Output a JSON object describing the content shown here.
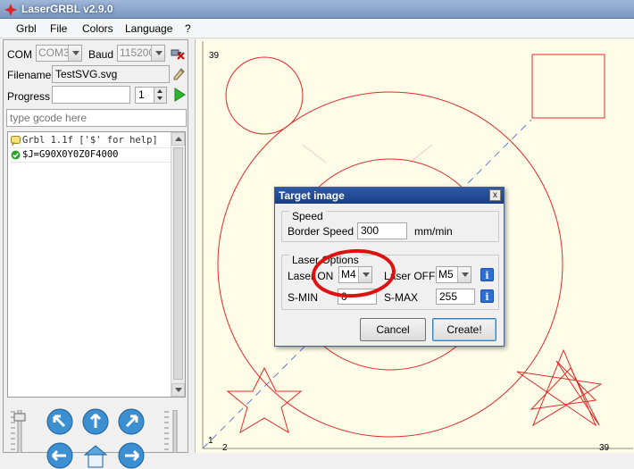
{
  "window": {
    "title": "LaserGRBL v2.9.0"
  },
  "menu": [
    "Grbl",
    "File",
    "Colors",
    "Language",
    "?"
  ],
  "connection": {
    "com_label": "COM",
    "com_value": "COM3",
    "baud_label": "Baud",
    "baud_value": "115200"
  },
  "file": {
    "filename_label": "Filename",
    "filename_value": "TestSVG.svg"
  },
  "progress": {
    "label": "Progress",
    "passes": "1"
  },
  "gcode_input": {
    "placeholder": "type gcode here"
  },
  "console": {
    "lines": [
      {
        "text": "Grbl 1.1f ['$' for help]",
        "icon": "info-bubble-icon"
      },
      {
        "text": "$J=G90X0Y0Z0F4000",
        "icon": "check-ok-icon"
      }
    ]
  },
  "canvas": {
    "y_top_label": "39",
    "y_bottom_label": "1",
    "x_left_label": "2",
    "x_right_label": "39"
  },
  "dialog": {
    "title": "Target image",
    "close_label": "x",
    "speed_group": "Speed",
    "border_speed_label": "Border Speed",
    "border_speed_value": "300",
    "speed_unit": "mm/min",
    "laser_group": "Laser Options",
    "laser_on_label": "Laser ON",
    "laser_on_value": "M4",
    "laser_off_label": "Laser OFF",
    "laser_off_value": "M5",
    "smin_label": "S-MIN",
    "smin_value": "0",
    "smax_label": "S-MAX",
    "smax_value": "255",
    "info_label": "i",
    "cancel_label": "Cancel",
    "create_label": "Create!"
  },
  "colors": {
    "drawing": "#e02a2a",
    "canvas_bg": "#fffde8",
    "path_dash": "#5b7fd6",
    "annotation": "#e01010"
  }
}
